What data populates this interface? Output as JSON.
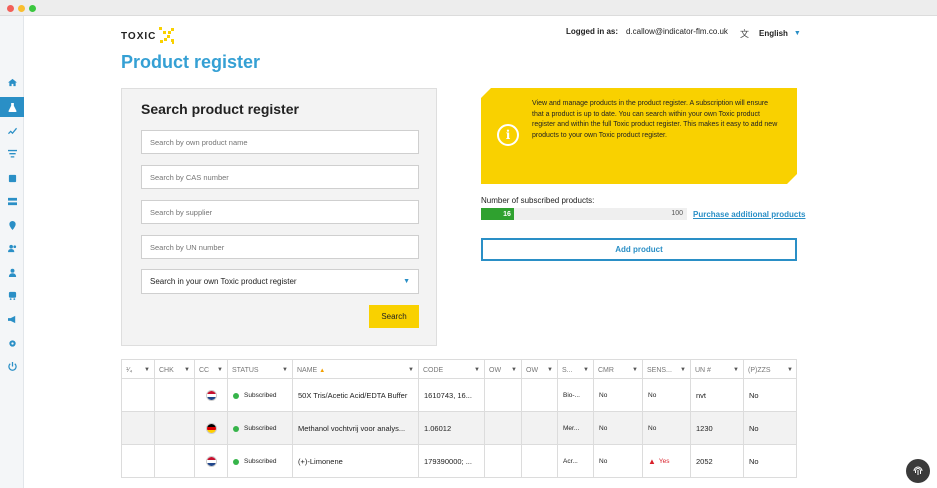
{
  "brand": {
    "logo_text": "TOXIC",
    "accent": "#f9d100",
    "primary": "#2a8fc6"
  },
  "header": {
    "logged_in_label": "Logged in as:",
    "user_email": "d.callow@indicator-flm.co.uk",
    "language": "English"
  },
  "sidebar": {
    "items": [
      {
        "icon": "home-icon"
      },
      {
        "icon": "product-register-icon",
        "active": true
      },
      {
        "icon": "chart-icon"
      },
      {
        "icon": "filter-icon"
      },
      {
        "icon": "document-icon"
      },
      {
        "icon": "storage-icon"
      },
      {
        "icon": "location-icon"
      },
      {
        "icon": "user-group-icon"
      },
      {
        "icon": "user-icon"
      },
      {
        "icon": "vehicle-icon"
      },
      {
        "icon": "megaphone-icon"
      },
      {
        "icon": "gear-icon"
      },
      {
        "icon": "power-icon"
      }
    ]
  },
  "page": {
    "title": "Product register"
  },
  "search": {
    "title": "Search product register",
    "fields": [
      {
        "placeholder": "Search by own product name"
      },
      {
        "placeholder": "Search by CAS number"
      },
      {
        "placeholder": "Search by supplier"
      },
      {
        "placeholder": "Search by UN number"
      }
    ],
    "scope_select": "Search in your own Toxic product register",
    "button": "Search"
  },
  "info": {
    "text": "View and manage products in the product register. A subscription will ensure that a product is up to date. You can search within your own Toxic product register and within the full Toxic product register. This makes it easy to add new products to your own Toxic product register."
  },
  "subscription": {
    "label": "Number of subscribed products:",
    "current": "16",
    "max": "100",
    "fill_fraction": 0.16,
    "purchase_link": "Purchase additional products",
    "add_button": "Add product"
  },
  "table": {
    "columns": [
      "¹⁄₄",
      "CHK",
      "CC",
      "STATUS",
      "NAME",
      "CODE",
      "OW",
      "OW",
      "S...",
      "CMR",
      "SENS...",
      "UN #",
      "(P)ZZS"
    ],
    "rows": [
      {
        "flag": "nl",
        "status": "Subscribed",
        "name": "50X Tris/Acetic Acid/EDTA Buffer",
        "code": "1610743, 16...",
        "s": "Bio-...",
        "cmr": "No",
        "sens": "No",
        "sens_warn": false,
        "un": "nvt",
        "pzzs": "No"
      },
      {
        "flag": "de",
        "status": "Subscribed",
        "name": "Methanol vochtvrij voor analys...",
        "code": "1.06012",
        "s": "Mer...",
        "cmr": "No",
        "sens": "No",
        "sens_warn": false,
        "un": "1230",
        "pzzs": "No"
      },
      {
        "flag": "nl",
        "status": "Subscribed",
        "name": "(+)-Limonene",
        "code": "179390000; ...",
        "s": "Acr...",
        "cmr": "No",
        "sens": "Yes",
        "sens_warn": true,
        "un": "2052",
        "pzzs": "No"
      }
    ]
  }
}
